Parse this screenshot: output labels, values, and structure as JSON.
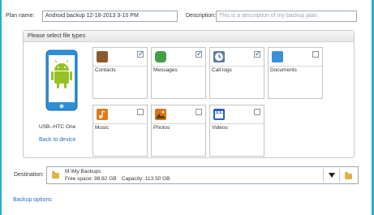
{
  "plan": {
    "name_label": "Plan name:",
    "name_value": "Android backup 12-18-2013 3-10 PM",
    "description_label": "Description:",
    "description_placeholder": "This is a description of my backup plan."
  },
  "file_types": {
    "header": "Please select file types",
    "device_name": "USB--HTC One",
    "back_link": "Back to device",
    "tiles": [
      {
        "label": "Contacts",
        "checked": true,
        "icon": "contacts-book-icon",
        "color": "#8b5a2b"
      },
      {
        "label": "Messages",
        "checked": true,
        "icon": "messages-icon",
        "color": "#43a047"
      },
      {
        "label": "Call logs",
        "checked": true,
        "icon": "call-logs-clock-icon",
        "color": "#5a7fa6"
      },
      {
        "label": "Documents",
        "checked": false,
        "icon": "documents-icon",
        "color": "#3b8fd9"
      },
      {
        "label": "Music",
        "checked": false,
        "icon": "music-note-icon",
        "color": "#e07b17"
      },
      {
        "label": "Photos",
        "checked": false,
        "icon": "photos-icon",
        "color": "#d3741b"
      },
      {
        "label": "Videos",
        "checked": false,
        "icon": "videos-clapper-icon",
        "color": "#2a5fbf"
      }
    ]
  },
  "destination": {
    "label": "Destination:",
    "path": "M:\\My Backups",
    "free_space": "Free space: 98.82 GB",
    "capacity": "Capacity: 113.50 GB"
  },
  "backup_options_link": "Backup options",
  "colors": {
    "frame": "#2aa7dd",
    "link": "#2c6fbe",
    "phone_body": "#2d8fd6",
    "android_green": "#97c024"
  }
}
